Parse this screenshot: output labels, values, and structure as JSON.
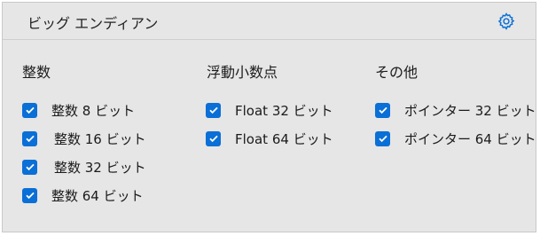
{
  "panel": {
    "title": "ビッグ エンディアン",
    "settings_icon": "gear-icon"
  },
  "colors": {
    "accent": "#0a6fd6",
    "panel_bg": "#e6e6e6"
  },
  "groups": [
    {
      "title": "整数",
      "items": [
        {
          "label": "整数 8 ビット",
          "checked": true
        },
        {
          "label": "整数 16 ビット",
          "checked": true
        },
        {
          "label": "整数 32 ビット",
          "checked": true
        },
        {
          "label": "整数 64 ビット",
          "checked": true
        }
      ]
    },
    {
      "title": "浮動小数点",
      "items": [
        {
          "label": "Float 32 ビット",
          "checked": true
        },
        {
          "label": "Float 64 ビット",
          "checked": true
        }
      ]
    },
    {
      "title": "その他",
      "items": [
        {
          "label": "ポインター 32 ビット",
          "checked": true
        },
        {
          "label": "ポインター 64 ビット",
          "checked": true
        }
      ]
    }
  ]
}
